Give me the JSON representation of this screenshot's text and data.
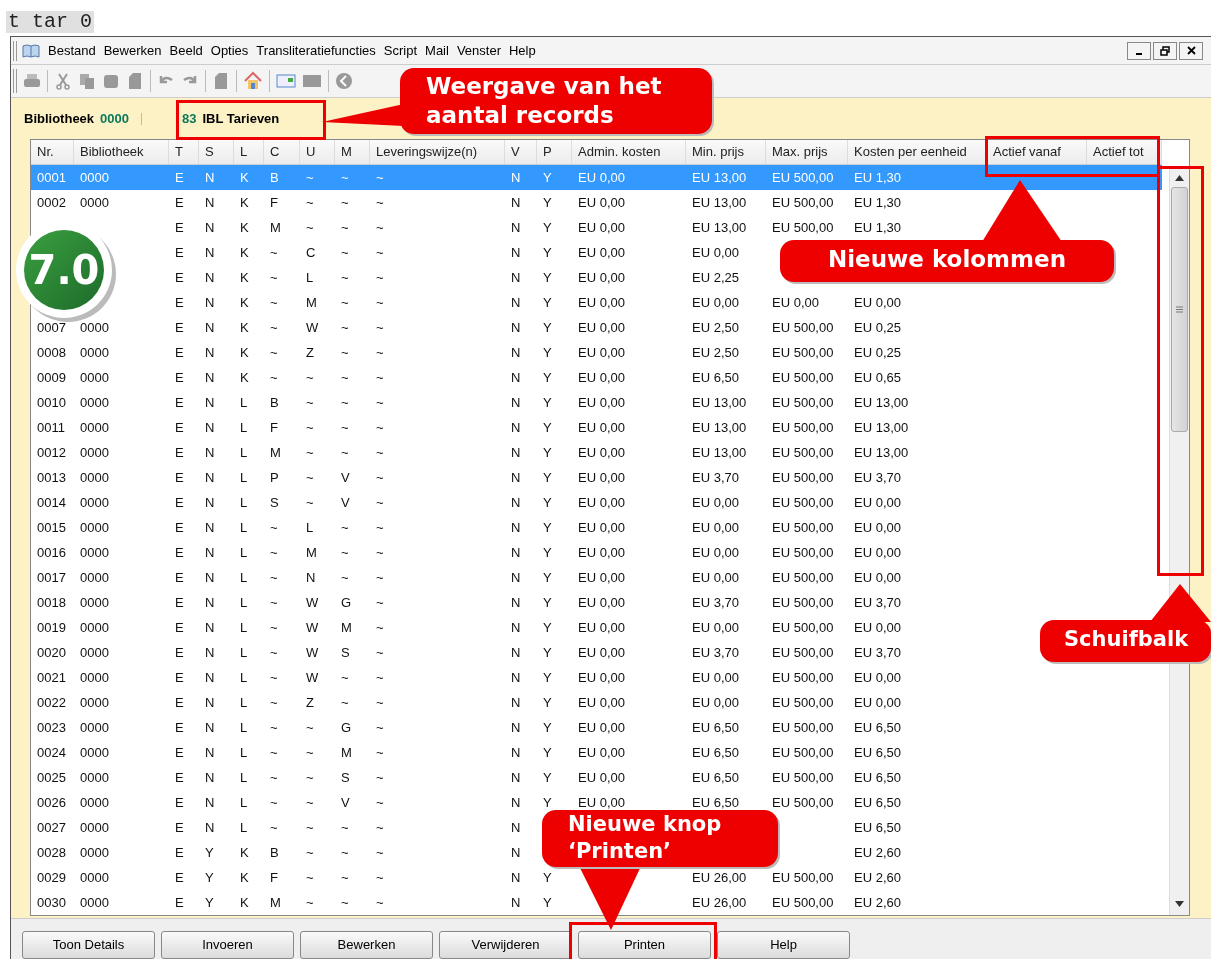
{
  "top_label": "t tar 0",
  "menu": [
    "Bestand",
    "Bewerken",
    "Beeld",
    "Opties",
    "Transliteratiefuncties",
    "Script",
    "Mail",
    "Venster",
    "Help"
  ],
  "header": {
    "library_label": "Bibliotheek",
    "library_code": "0000",
    "record_count": "83",
    "title": "IBL Tarieven"
  },
  "table": {
    "columns": [
      "Nr.",
      "Bibliotheek",
      "T",
      "S",
      "L",
      "C",
      "U",
      "M",
      "Leveringswijze(n)",
      "V",
      "P",
      "Admin. kosten",
      "Min. prijs",
      "Max. prijs",
      "Kosten per eenheid",
      "Actief vanaf",
      "Actief tot"
    ],
    "rows": [
      {
        "selected": true,
        "cells": [
          "0001",
          "0000",
          "E",
          "N",
          "K",
          "B",
          "~",
          "~",
          "~",
          "N",
          "Y",
          "EU 0,00",
          "EU 13,00",
          "EU 500,00",
          "EU 1,30"
        ]
      },
      {
        "selected": false,
        "cells": [
          "0002",
          "0000",
          "E",
          "N",
          "K",
          "F",
          "~",
          "~",
          "~",
          "N",
          "Y",
          "EU 0,00",
          "EU 13,00",
          "EU 500,00",
          "EU 1,30"
        ]
      },
      {
        "selected": false,
        "cells": [
          null,
          null,
          "E",
          "N",
          "K",
          "M",
          "~",
          "~",
          "~",
          "N",
          "Y",
          "EU 0,00",
          "EU 13,00",
          "EU 500,00",
          "EU 1,30"
        ]
      },
      {
        "selected": false,
        "cells": [
          null,
          null,
          "E",
          "N",
          "K",
          "~",
          "C",
          "~",
          "~",
          "N",
          "Y",
          "EU 0,00",
          "EU 0,00",
          null,
          null
        ]
      },
      {
        "selected": false,
        "cells": [
          null,
          null,
          "E",
          "N",
          "K",
          "~",
          "L",
          "~",
          "~",
          "N",
          "Y",
          "EU 0,00",
          "EU 2,25",
          null,
          null
        ]
      },
      {
        "selected": false,
        "cells": [
          null,
          null,
          "E",
          "N",
          "K",
          "~",
          "M",
          "~",
          "~",
          "N",
          "Y",
          "EU 0,00",
          "EU 0,00",
          "EU 0,00",
          "EU 0,00"
        ]
      },
      {
        "selected": false,
        "cells": [
          "0007",
          "0000",
          "E",
          "N",
          "K",
          "~",
          "W",
          "~",
          "~",
          "N",
          "Y",
          "EU 0,00",
          "EU 2,50",
          "EU 500,00",
          "EU 0,25"
        ]
      },
      {
        "selected": false,
        "cells": [
          "0008",
          "0000",
          "E",
          "N",
          "K",
          "~",
          "Z",
          "~",
          "~",
          "N",
          "Y",
          "EU 0,00",
          "EU 2,50",
          "EU 500,00",
          "EU 0,25"
        ]
      },
      {
        "selected": false,
        "cells": [
          "0009",
          "0000",
          "E",
          "N",
          "K",
          "~",
          "~",
          "~",
          "~",
          "N",
          "Y",
          "EU 0,00",
          "EU 6,50",
          "EU 500,00",
          "EU 0,65"
        ]
      },
      {
        "selected": false,
        "cells": [
          "0010",
          "0000",
          "E",
          "N",
          "L",
          "B",
          "~",
          "~",
          "~",
          "N",
          "Y",
          "EU 0,00",
          "EU 13,00",
          "EU 500,00",
          "EU 13,00"
        ]
      },
      {
        "selected": false,
        "cells": [
          "0011",
          "0000",
          "E",
          "N",
          "L",
          "F",
          "~",
          "~",
          "~",
          "N",
          "Y",
          "EU 0,00",
          "EU 13,00",
          "EU 500,00",
          "EU 13,00"
        ]
      },
      {
        "selected": false,
        "cells": [
          "0012",
          "0000",
          "E",
          "N",
          "L",
          "M",
          "~",
          "~",
          "~",
          "N",
          "Y",
          "EU 0,00",
          "EU 13,00",
          "EU 500,00",
          "EU 13,00"
        ]
      },
      {
        "selected": false,
        "cells": [
          "0013",
          "0000",
          "E",
          "N",
          "L",
          "P",
          "~",
          "V",
          "~",
          "N",
          "Y",
          "EU 0,00",
          "EU 3,70",
          "EU 500,00",
          "EU 3,70"
        ]
      },
      {
        "selected": false,
        "cells": [
          "0014",
          "0000",
          "E",
          "N",
          "L",
          "S",
          "~",
          "V",
          "~",
          "N",
          "Y",
          "EU 0,00",
          "EU 0,00",
          "EU 500,00",
          "EU 0,00"
        ]
      },
      {
        "selected": false,
        "cells": [
          "0015",
          "0000",
          "E",
          "N",
          "L",
          "~",
          "L",
          "~",
          "~",
          "N",
          "Y",
          "EU 0,00",
          "EU 0,00",
          "EU 500,00",
          "EU 0,00"
        ]
      },
      {
        "selected": false,
        "cells": [
          "0016",
          "0000",
          "E",
          "N",
          "L",
          "~",
          "M",
          "~",
          "~",
          "N",
          "Y",
          "EU 0,00",
          "EU 0,00",
          "EU 500,00",
          "EU 0,00"
        ]
      },
      {
        "selected": false,
        "cells": [
          "0017",
          "0000",
          "E",
          "N",
          "L",
          "~",
          "N",
          "~",
          "~",
          "N",
          "Y",
          "EU 0,00",
          "EU 0,00",
          "EU 500,00",
          "EU 0,00"
        ]
      },
      {
        "selected": false,
        "cells": [
          "0018",
          "0000",
          "E",
          "N",
          "L",
          "~",
          "W",
          "G",
          "~",
          "N",
          "Y",
          "EU 0,00",
          "EU 3,70",
          "EU 500,00",
          "EU 3,70"
        ]
      },
      {
        "selected": false,
        "cells": [
          "0019",
          "0000",
          "E",
          "N",
          "L",
          "~",
          "W",
          "M",
          "~",
          "N",
          "Y",
          "EU 0,00",
          "EU 0,00",
          "EU 500,00",
          "EU 0,00"
        ]
      },
      {
        "selected": false,
        "cells": [
          "0020",
          "0000",
          "E",
          "N",
          "L",
          "~",
          "W",
          "S",
          "~",
          "N",
          "Y",
          "EU 0,00",
          "EU 3,70",
          "EU 500,00",
          "EU 3,70"
        ]
      },
      {
        "selected": false,
        "cells": [
          "0021",
          "0000",
          "E",
          "N",
          "L",
          "~",
          "W",
          "~",
          "~",
          "N",
          "Y",
          "EU 0,00",
          "EU 0,00",
          "EU 500,00",
          "EU 0,00"
        ]
      },
      {
        "selected": false,
        "cells": [
          "0022",
          "0000",
          "E",
          "N",
          "L",
          "~",
          "Z",
          "~",
          "~",
          "N",
          "Y",
          "EU 0,00",
          "EU 0,00",
          "EU 500,00",
          "EU 0,00"
        ]
      },
      {
        "selected": false,
        "cells": [
          "0023",
          "0000",
          "E",
          "N",
          "L",
          "~",
          "~",
          "G",
          "~",
          "N",
          "Y",
          "EU 0,00",
          "EU 6,50",
          "EU 500,00",
          "EU 6,50"
        ]
      },
      {
        "selected": false,
        "cells": [
          "0024",
          "0000",
          "E",
          "N",
          "L",
          "~",
          "~",
          "M",
          "~",
          "N",
          "Y",
          "EU 0,00",
          "EU 6,50",
          "EU 500,00",
          "EU 6,50"
        ]
      },
      {
        "selected": false,
        "cells": [
          "0025",
          "0000",
          "E",
          "N",
          "L",
          "~",
          "~",
          "S",
          "~",
          "N",
          "Y",
          "EU 0,00",
          "EU 6,50",
          "EU 500,00",
          "EU 6,50"
        ]
      },
      {
        "selected": false,
        "cells": [
          "0026",
          "0000",
          "E",
          "N",
          "L",
          "~",
          "~",
          "V",
          "~",
          "N",
          "Y",
          "EU 0,00",
          "EU 6,50",
          "EU 500,00",
          "EU 6,50"
        ]
      },
      {
        "selected": false,
        "cells": [
          "0027",
          "0000",
          "E",
          "N",
          "L",
          "~",
          "~",
          "~",
          "~",
          "N",
          null,
          null,
          null,
          null,
          "EU 6,50"
        ]
      },
      {
        "selected": false,
        "cells": [
          "0028",
          "0000",
          "E",
          "Y",
          "K",
          "B",
          "~",
          "~",
          "~",
          "N",
          null,
          null,
          null,
          null,
          "EU 2,60"
        ]
      },
      {
        "selected": false,
        "cells": [
          "0029",
          "0000",
          "E",
          "Y",
          "K",
          "F",
          "~",
          "~",
          "~",
          "N",
          "Y",
          null,
          "EU 26,00",
          "EU 500,00",
          "EU 2,60"
        ]
      },
      {
        "selected": false,
        "cells": [
          "0030",
          "0000",
          "E",
          "Y",
          "K",
          "M",
          "~",
          "~",
          "~",
          "N",
          "Y",
          null,
          "EU 26,00",
          "EU 500,00",
          "EU 2,60"
        ]
      }
    ]
  },
  "buttons": [
    "Toon Details",
    "Invoeren",
    "Bewerken",
    "Verwijderen",
    "Printen",
    "Help"
  ],
  "version_badge": "7.0",
  "callouts": [
    "Weergave van het aantal records",
    "Nieuwe kolommen",
    "Schuifbalk",
    "Nieuwe knop ‘Printen’"
  ]
}
